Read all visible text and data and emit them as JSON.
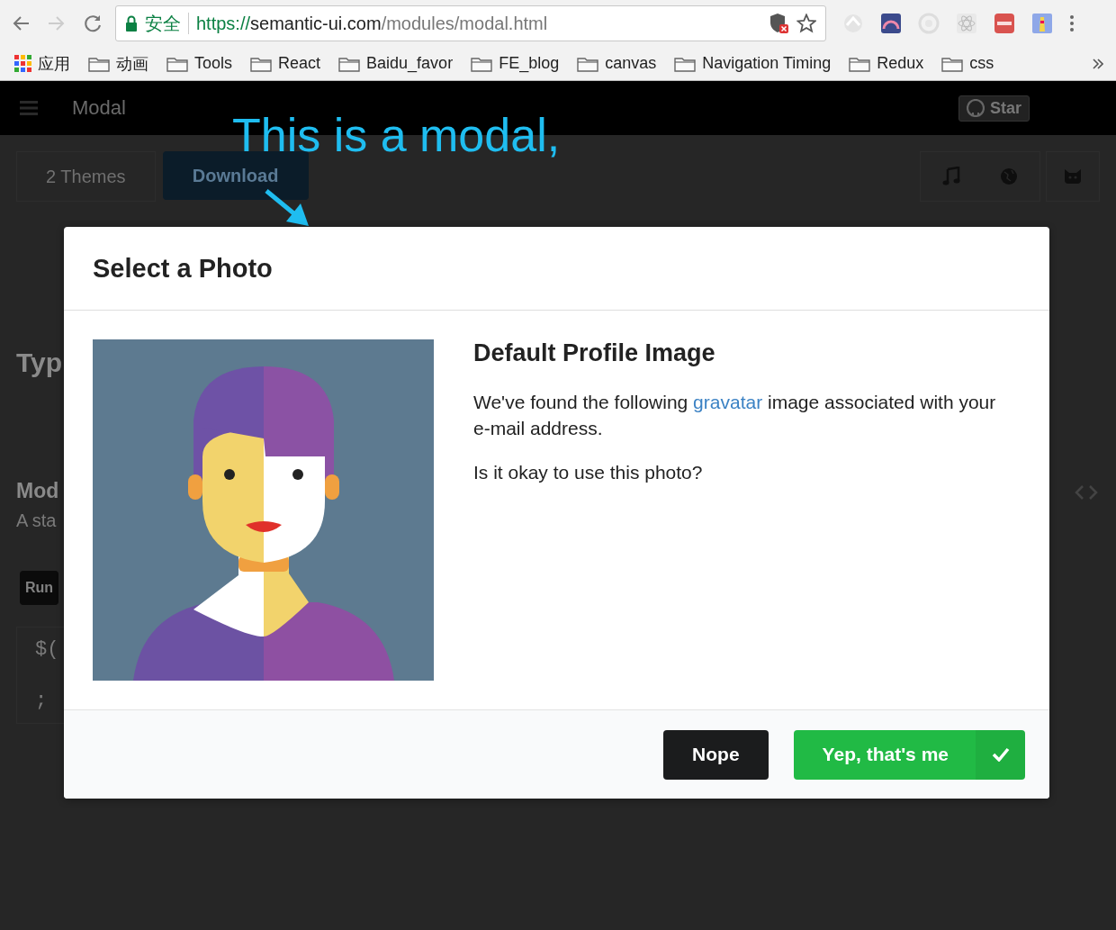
{
  "browser": {
    "security_label": "安全",
    "url": {
      "scheme": "https://",
      "host": "semantic-ui.com",
      "path": "/modules/modal.html"
    },
    "bookmarks": [
      {
        "label": "应用",
        "kind": "apps"
      },
      {
        "label": "动画",
        "kind": "folder"
      },
      {
        "label": "Tools",
        "kind": "folder"
      },
      {
        "label": "React",
        "kind": "folder"
      },
      {
        "label": "Baidu_favor",
        "kind": "folder"
      },
      {
        "label": "FE_blog",
        "kind": "folder"
      },
      {
        "label": "canvas",
        "kind": "folder"
      },
      {
        "label": "Navigation Timing",
        "kind": "folder"
      },
      {
        "label": "Redux",
        "kind": "folder"
      },
      {
        "label": "css",
        "kind": "folder"
      }
    ]
  },
  "page": {
    "header_title": "Modal",
    "star_label": "Star",
    "menu_items": [
      "2 Themes",
      "Download"
    ],
    "heading": "Typ",
    "subheading": "Mod",
    "description": "A sta",
    "run_label": "Run",
    "code_lines": [
      "$(",
      ";"
    ]
  },
  "annotation": {
    "text": "This is a modal,"
  },
  "modal": {
    "title": "Select a Photo",
    "content_heading": "Default Profile Image",
    "message": {
      "before": "We've found the following ",
      "link": "gravatar",
      "after": " image associated with your e-mail address."
    },
    "question": "Is it okay to use this photo?",
    "buttons": [
      {
        "label": "Nope",
        "kind": "negative"
      },
      {
        "label": "Yep, that's me",
        "kind": "positive"
      }
    ]
  }
}
